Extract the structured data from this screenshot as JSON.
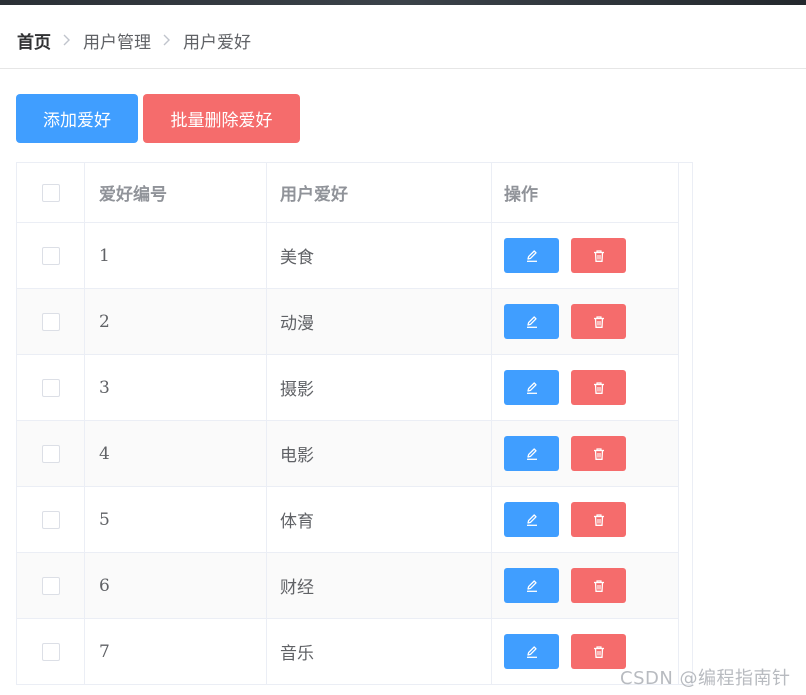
{
  "breadcrumb": {
    "items": [
      "首页",
      "用户管理",
      "用户爱好"
    ]
  },
  "toolbar": {
    "add_label": "添加爱好",
    "batch_delete_label": "批量删除爱好"
  },
  "table": {
    "columns": [
      "爱好编号",
      "用户爱好",
      "操作"
    ],
    "rows": [
      {
        "id": "1",
        "hobby": "美食"
      },
      {
        "id": "2",
        "hobby": "动漫"
      },
      {
        "id": "3",
        "hobby": "摄影"
      },
      {
        "id": "4",
        "hobby": "电影"
      },
      {
        "id": "5",
        "hobby": "体育"
      },
      {
        "id": "6",
        "hobby": "财经"
      },
      {
        "id": "7",
        "hobby": "音乐"
      }
    ],
    "row_actions": {
      "edit_icon": "edit-icon",
      "delete_icon": "trash-icon"
    }
  },
  "watermark": "CSDN @编程指南针",
  "colors": {
    "primary": "#409eff",
    "danger": "#f56c6c",
    "border": "#ebeef5",
    "stripe": "#fafafa"
  }
}
